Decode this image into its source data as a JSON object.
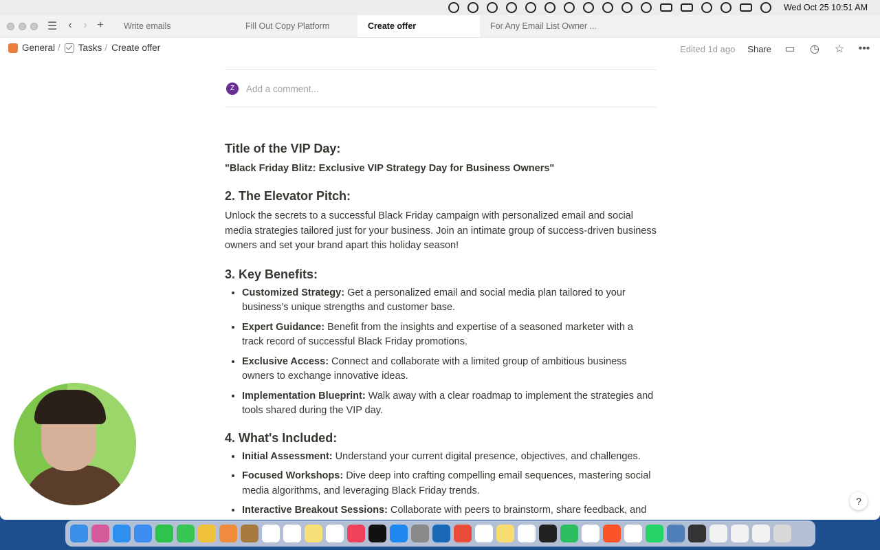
{
  "menubar": {
    "clock": "Wed Oct 25  10:51 AM"
  },
  "tabs": [
    {
      "label": "Write emails"
    },
    {
      "label": "Fill Out Copy Platform"
    },
    {
      "label": "Create offer"
    },
    {
      "label": "For Any Email List Owner ..."
    }
  ],
  "breadcrumb": {
    "general": "General",
    "tasks": "Tasks",
    "current": "Create offer"
  },
  "topbar": {
    "edited": "Edited 1d ago",
    "share": "Share"
  },
  "comment": {
    "avatar_initial": "Z",
    "placeholder": "Add a comment..."
  },
  "doc": {
    "title_heading": "Title of the VIP Day:",
    "title_value": "\"Black Friday Blitz: Exclusive VIP Strategy Day for Business Owners\"",
    "pitch_heading": "2. The Elevator Pitch:",
    "pitch_body": "Unlock the secrets to a successful Black Friday campaign with personalized email and social media strategies tailored just for your business. Join an intimate group of success-driven business owners and set your brand apart this holiday season!",
    "benefits_heading": "3. Key Benefits:",
    "benefits": [
      {
        "term": "Customized Strategy:",
        "text": " Get a personalized email and social media plan tailored to your business’s unique strengths and customer base."
      },
      {
        "term": "Expert Guidance:",
        "text": " Benefit from the insights and expertise of a seasoned marketer with a track record of successful Black Friday promotions."
      },
      {
        "term": "Exclusive Access:",
        "text": " Connect and collaborate with a limited group of ambitious business owners to exchange innovative ideas."
      },
      {
        "term": "Implementation Blueprint:",
        "text": " Walk away with a clear roadmap to implement the strategies and tools shared during the VIP day."
      }
    ],
    "included_heading": "4. What's Included:",
    "included": [
      {
        "term": "Initial Assessment:",
        "text": " Understand your current digital presence, objectives, and challenges."
      },
      {
        "term": "Focused Workshops:",
        "text": " Dive deep into crafting compelling email sequences, mastering social media algorithms, and leveraging Black Friday trends."
      },
      {
        "term": "Interactive Breakout Sessions:",
        "text": " Collaborate with peers to brainstorm, share feedback, and refine your strategies."
      }
    ]
  },
  "help": {
    "label": "?"
  },
  "colors": {
    "accent": "#e9803b",
    "avatar": "#6a2f95"
  }
}
